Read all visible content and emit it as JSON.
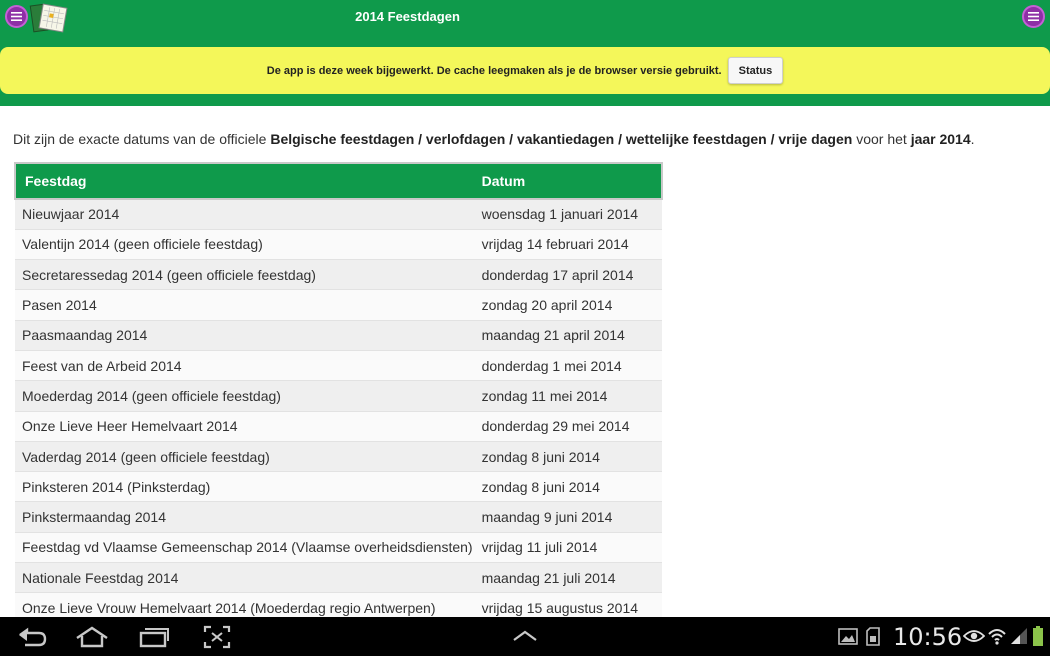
{
  "header": {
    "title": "2014 Feestdagen",
    "notice_text": "De app is deze week bijgewerkt. De cache leegmaken als je de browser versie gebruikt.",
    "status_button": "Status"
  },
  "intro": {
    "part1": "Dit zijn de exacte datums van de officiele ",
    "bold1": "Belgische feestdagen / verlofdagen / vakantiedagen / wettelijke feestdagen / vrije dagen",
    "part2": " voor het ",
    "bold2": "jaar 2014",
    "part3": "."
  },
  "table": {
    "headers": [
      "Feestdag",
      "Datum"
    ],
    "rows": [
      [
        "Nieuwjaar 2014",
        "woensdag 1 januari 2014"
      ],
      [
        "Valentijn 2014 (geen officiele feestdag)",
        "vrijdag 14 februari 2014"
      ],
      [
        "Secretaressedag 2014 (geen officiele feestdag)",
        "donderdag 17 april 2014"
      ],
      [
        "Pasen 2014",
        "zondag 20 april 2014"
      ],
      [
        "Paasmaandag 2014",
        "maandag 21 april 2014"
      ],
      [
        "Feest van de Arbeid 2014",
        "donderdag 1 mei 2014"
      ],
      [
        "Moederdag 2014 (geen officiele feestdag)",
        "zondag 11 mei 2014"
      ],
      [
        "Onze Lieve Heer Hemelvaart 2014",
        "donderdag 29 mei 2014"
      ],
      [
        "Vaderdag 2014 (geen officiele feestdag)",
        "zondag 8 juni 2014"
      ],
      [
        "Pinksteren 2014 (Pinksterdag)",
        "zondag 8 juni 2014"
      ],
      [
        "Pinkstermaandag 2014",
        "maandag 9 juni 2014"
      ],
      [
        "Feestdag vd Vlaamse Gemeenschap 2014 (Vlaamse overheidsdiensten)",
        "vrijdag 11 juli 2014"
      ],
      [
        "Nationale Feestdag 2014",
        "maandag 21 juli 2014"
      ],
      [
        "Onze Lieve Vrouw Hemelvaart 2014 (Moederdag regio Antwerpen)",
        "vrijdag 15 augustus 2014"
      ]
    ]
  },
  "statusbar": {
    "time": "10:56"
  },
  "icons": {
    "menu_left": "menu-icon",
    "menu_right": "menu-icon",
    "logo": "calendar-logo",
    "nav": [
      "back-icon",
      "home-icon",
      "recent-apps-icon",
      "screenshot-icon",
      "chevron-up-icon"
    ],
    "status": [
      "gallery-icon",
      "sd-card-icon",
      "eye-icon",
      "wifi-icon",
      "signal-icon",
      "battery-icon"
    ]
  },
  "colors": {
    "header_green": "#0f9a4b",
    "notice_yellow": "#f4f75a",
    "menu_purple": "#8e2fa6"
  }
}
